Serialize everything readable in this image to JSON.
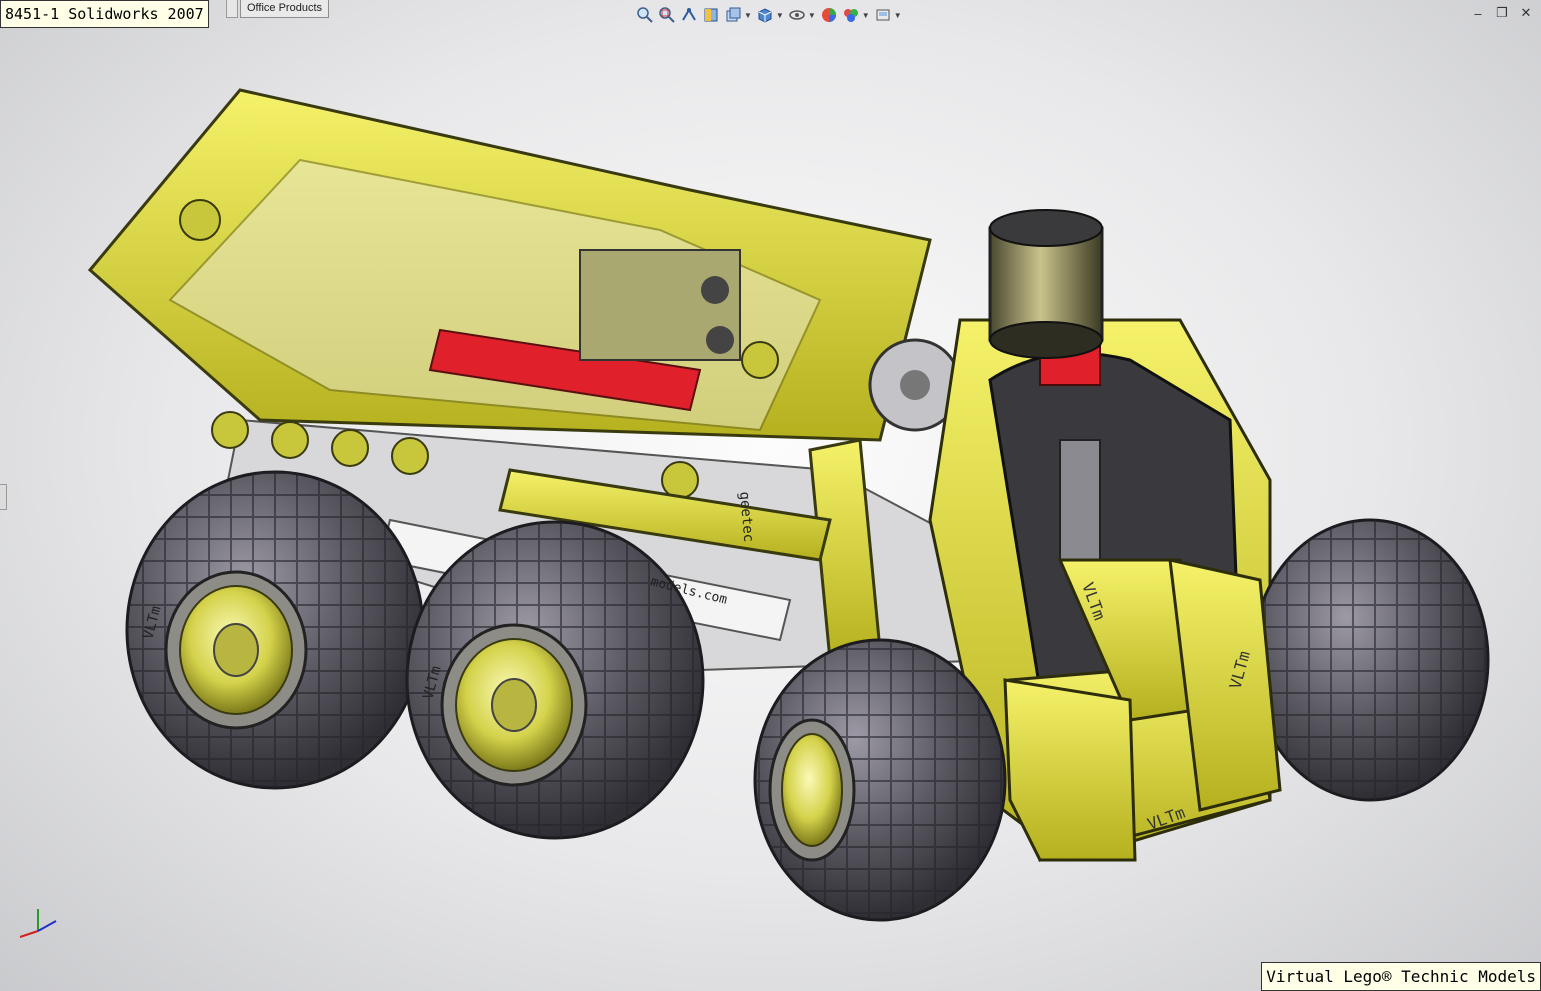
{
  "window": {
    "title": "8451-1 Solidworks 2007"
  },
  "tabs": [
    {
      "label": "Office Products"
    }
  ],
  "toolbar": {
    "buttons": [
      {
        "icon": "zoom-to-fit-icon"
      },
      {
        "icon": "zoom-to-area-icon"
      },
      {
        "icon": "previous-view-icon"
      },
      {
        "icon": "section-view-icon"
      },
      {
        "icon": "view-orientation-icon",
        "dropdown": true
      },
      {
        "icon": "display-style-icon",
        "dropdown": true
      },
      {
        "icon": "hide-show-items-icon",
        "dropdown": true
      },
      {
        "icon": "edit-appearance-icon"
      },
      {
        "icon": "apply-scene-icon",
        "dropdown": true
      },
      {
        "icon": "view-settings-icon",
        "dropdown": true
      }
    ]
  },
  "window_controls": {
    "minimize": "–",
    "restore": "❐",
    "close": "✕"
  },
  "model_labels": {
    "vltm": "VLTm",
    "website_front": "models.com",
    "website_side": "geetec"
  },
  "credit": {
    "text": "Virtual Lego® Technic Models"
  },
  "colors": {
    "lego_yellow": "#e6e23a",
    "tire_dark": "#55555e",
    "red_part": "#e0202a"
  }
}
